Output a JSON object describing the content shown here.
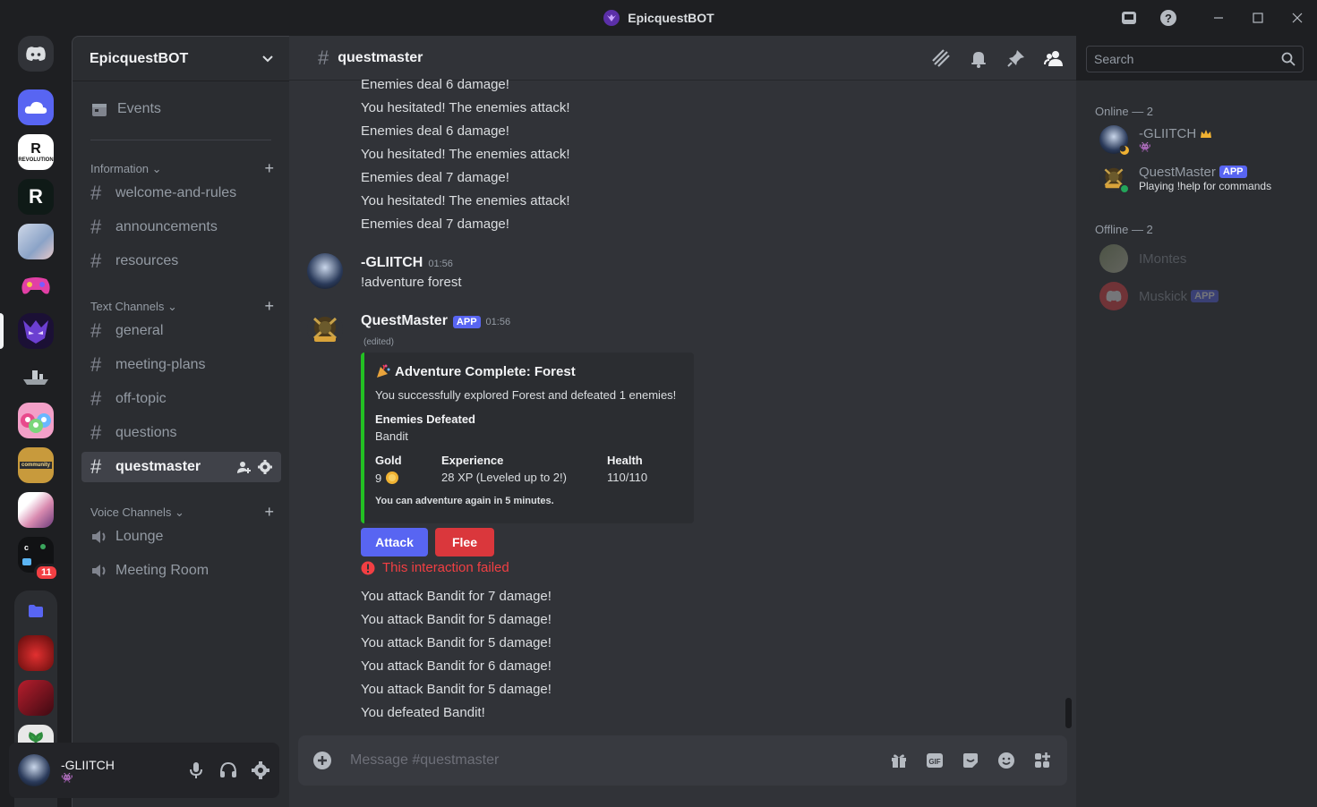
{
  "window": {
    "title": "EpicquestBOT",
    "controls": [
      "inbox-icon",
      "help-icon",
      "minimize-icon",
      "maximize-icon",
      "close-icon"
    ]
  },
  "servers": [
    {
      "name": "Discord Home",
      "icon": "discord-logo"
    },
    {
      "name": "cloud server",
      "icon": "cloud-icon"
    },
    {
      "name": "Revolution",
      "label": "REVOLUTION"
    },
    {
      "name": "R server",
      "label": "R"
    },
    {
      "name": "anime server"
    },
    {
      "name": "gamepad server"
    },
    {
      "name": "EpicquestBOT",
      "active": true
    },
    {
      "name": "ship server"
    },
    {
      "name": "powerpuff server"
    },
    {
      "name": "community server",
      "label": "community"
    },
    {
      "name": "avatar server"
    },
    {
      "name": "multi server",
      "badge": "11"
    },
    {
      "name": "folder",
      "icon": "folder-icon"
    },
    {
      "name": "red monster server"
    },
    {
      "name": "ninja server"
    },
    {
      "name": "plant server"
    }
  ],
  "sidebar": {
    "guild_name": "EpicquestBOT",
    "events_label": "Events",
    "categories": [
      {
        "name": "Information",
        "channels": [
          "welcome-and-rules",
          "announcements",
          "resources"
        ]
      },
      {
        "name": "Text Channels",
        "channels": [
          "general",
          "meeting-plans",
          "off-topic",
          "questions",
          "questmaster"
        ]
      },
      {
        "name": "Voice Channels",
        "channels": [
          "Lounge",
          "Meeting Room"
        ]
      }
    ],
    "active_channel": "questmaster"
  },
  "user_panel": {
    "username": "-GLIITCH",
    "status_icon": "alien-icon"
  },
  "channel": {
    "name": "questmaster",
    "search_placeholder": "Search"
  },
  "messages": {
    "top_lines": [
      "Enemies deal 6 damage!",
      "You hesitated! The enemies attack!",
      "Enemies deal 6 damage!",
      "You hesitated! The enemies attack!",
      "Enemies deal 7 damage!",
      "You hesitated! The enemies attack!",
      "Enemies deal 7 damage!"
    ],
    "user_msg": {
      "author": "-GLIITCH",
      "time": "01:56",
      "text": "!adventure forest"
    },
    "bot_msg": {
      "author": "QuestMaster",
      "tag": "APP",
      "time": "01:56",
      "edited": "(edited)",
      "embed": {
        "title": "Adventure Complete: Forest",
        "description": "You successfully explored Forest and defeated 1 enemies!",
        "enemies_label": "Enemies Defeated",
        "enemies_value": "Bandit",
        "gold_label": "Gold",
        "gold_value": "9",
        "xp_label": "Experience",
        "xp_value": "28 XP (Leveled up to 2!)",
        "health_label": "Health",
        "health_value": "110/110",
        "footer": "You can adventure again in 5 minutes.",
        "color": "#23c023"
      },
      "buttons": {
        "attack": "Attack",
        "flee": "Flee"
      },
      "failure": "This interaction failed",
      "after_lines": [
        "You attack Bandit for 7 damage!",
        "You attack Bandit for 5 damage!",
        "You attack Bandit for 5 damage!",
        "You attack Bandit for 6 damage!",
        "You attack Bandit for 5 damage!",
        "You defeated Bandit!"
      ]
    }
  },
  "composer": {
    "placeholder": "Message #questmaster"
  },
  "members": {
    "online_label": "Online — 2",
    "offline_label": "Offline — 2",
    "online": [
      {
        "name": "-GLIITCH",
        "badge_icon": "crown-icon"
      },
      {
        "name": "QuestMaster",
        "tag": "APP",
        "status": "Playing !help for commands"
      }
    ],
    "offline": [
      {
        "name": "IMontes"
      },
      {
        "name": "Muskick",
        "tag": "APP"
      }
    ]
  },
  "colors": {
    "accent": "#5865f2",
    "danger": "#da373c",
    "online": "#23a55a"
  }
}
